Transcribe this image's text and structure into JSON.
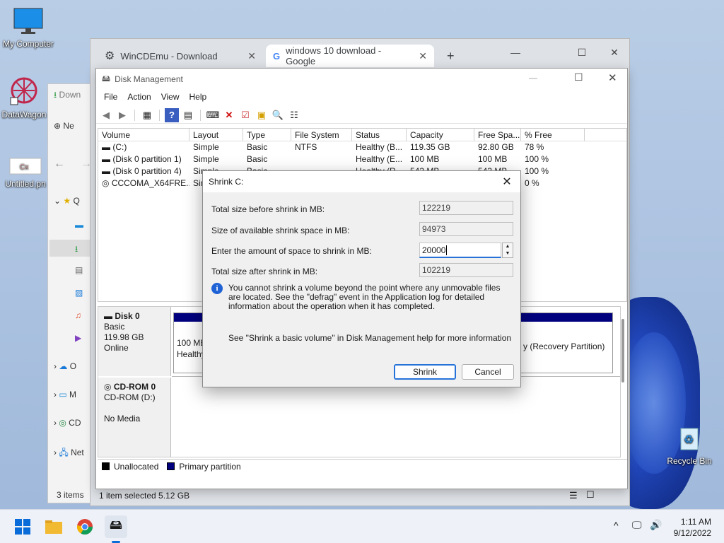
{
  "desktop": {
    "icons": [
      {
        "label": "My Computer"
      },
      {
        "label": "DataWagon"
      },
      {
        "label": "Untitled.pn"
      },
      {
        "label": "Recycle Bin"
      }
    ]
  },
  "explorer": {
    "tab": "Down",
    "new_label": "Ne",
    "quick_label": "Q",
    "onedrive_label": "O",
    "thispc_label": "M",
    "cd_label": "CD",
    "network_label": "Net",
    "status_items": "3 items",
    "status_selected": "1 item selected  5.12 GB"
  },
  "browser": {
    "tabs": [
      {
        "label": "WinCDEmu - Download"
      },
      {
        "label": "windows 10 download - Google"
      }
    ],
    "new_tab": "+"
  },
  "disk_management": {
    "title": "Disk Management",
    "menu": [
      "File",
      "Action",
      "View",
      "Help"
    ],
    "columns": [
      "Volume",
      "Layout",
      "Type",
      "File System",
      "Status",
      "Capacity",
      "Free Spa...",
      "% Free"
    ],
    "rows": [
      [
        "(C:)",
        "Simple",
        "Basic",
        "NTFS",
        "Healthy (B...",
        "119.35 GB",
        "92.80 GB",
        "78 %"
      ],
      [
        "(Disk 0 partition 1)",
        "Simple",
        "Basic",
        "",
        "Healthy (E...",
        "100 MB",
        "100 MB",
        "100 %"
      ],
      [
        "(Disk 0 partition 4)",
        "Simple",
        "Basic",
        "",
        "Healthy (R...",
        "543 MB",
        "543 MB",
        "100 %"
      ],
      [
        "CCCOMA_X64FRE...",
        "Simple",
        "",
        "",
        "",
        "",
        "",
        "0 %"
      ]
    ],
    "disk0": {
      "name": "Disk 0",
      "type": "Basic",
      "size": "119.98 GB",
      "state": "Online",
      "part_left_size": "100 MB",
      "part_left_status": "Healthy",
      "part_right": "y (Recovery Partition)"
    },
    "cdrom": {
      "name": "CD-ROM 0",
      "drive": "CD-ROM (D:)",
      "media": "No Media"
    },
    "legend": {
      "unallocated": "Unallocated",
      "primary": "Primary partition"
    }
  },
  "shrink_dialog": {
    "title": "Shrink C:",
    "close": "✕",
    "total_before_label": "Total size before shrink in MB:",
    "total_before_value": "122219",
    "available_label": "Size of available shrink space in MB:",
    "available_value": "94973",
    "amount_label": "Enter the amount of space to shrink in MB:",
    "amount_value": "20000",
    "total_after_label": "Total size after shrink in MB:",
    "total_after_value": "102219",
    "info_text": "You cannot shrink a volume beyond the point where any unmovable files are located. See the \"defrag\" event in the Application log for detailed information about the operation when it has completed.",
    "help_text": "See \"Shrink a basic volume\" in Disk Management help for more information",
    "shrink_button": "Shrink",
    "cancel_button": "Cancel"
  },
  "taskbar": {
    "time": "1:11 AM",
    "date": "9/12/2022"
  },
  "colors": {
    "accent": "#2672d9",
    "primary_partition": "#00007f",
    "unallocated": "#000000"
  }
}
